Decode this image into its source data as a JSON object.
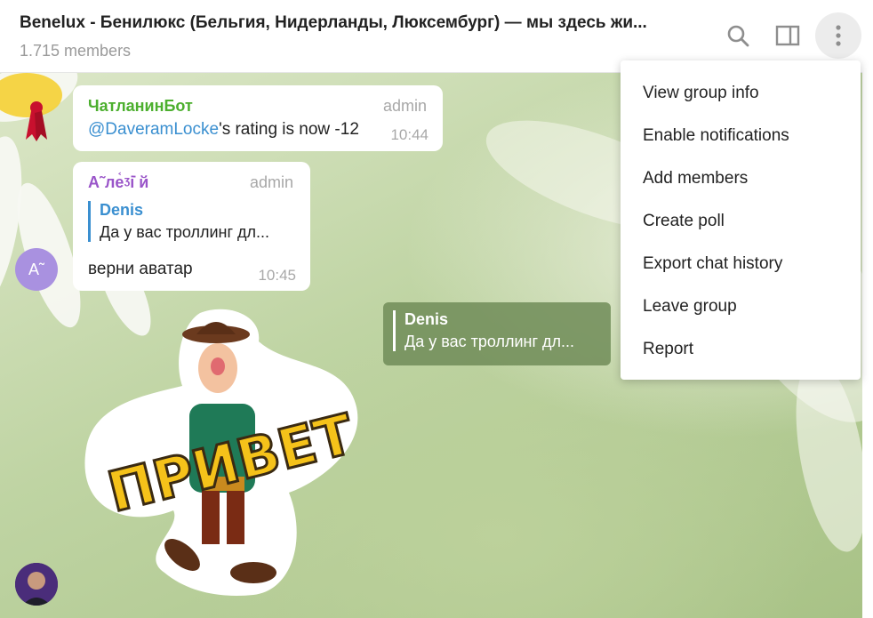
{
  "header": {
    "title": "Benelux - Бенилюкс (Бельгия, Нидерланды, Люксембург) — мы здесь жи...",
    "members": "1.715 members",
    "icons": [
      "search-icon",
      "sidebar-toggle-icon",
      "more-vertical-icon"
    ]
  },
  "messages": [
    {
      "sender": "ЧатланинБот",
      "role": "admin",
      "mention": "@DaveramLocke",
      "text": "'s rating is now -12",
      "time": "10:44",
      "name_color": "#4caf2e"
    },
    {
      "sender": "А˜лe᷾ᶾі̇ й",
      "role": "admin",
      "reply_name": "Denis",
      "reply_text": "Да у вас троллинг дл...",
      "text": "верни аватар",
      "time": "10:45",
      "name_color": "#9a55c9",
      "avatar_initials": "А˜",
      "avatar_color": "#a991e0"
    },
    {
      "sticker": "sticker-privet",
      "sticker_text": "ПРИВЕТ"
    }
  ],
  "reply_preview": {
    "name": "Denis",
    "text": "Да у вас троллинг дл..."
  },
  "menu": {
    "items": [
      "View group info",
      "Enable notifications",
      "Add members",
      "Create poll",
      "Export chat history",
      "Leave group",
      "Report"
    ]
  },
  "colors": {
    "accent": "#3a8fd0",
    "menu_bg": "#ffffff"
  }
}
